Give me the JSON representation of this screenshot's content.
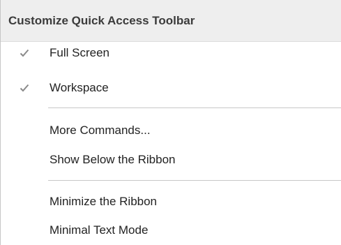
{
  "menu": {
    "title": "Customize Quick Access Toolbar",
    "items": [
      {
        "label": "Full Screen",
        "checked": true,
        "check_icon": "checkmark-icon"
      },
      {
        "label": "Workspace",
        "checked": true,
        "check_icon": "checkmark-icon"
      },
      {
        "label": "More Commands...",
        "checked": false
      },
      {
        "label": "Show Below the Ribbon",
        "checked": false
      },
      {
        "label": "Minimize the Ribbon",
        "checked": false
      },
      {
        "label": "Minimal Text Mode",
        "checked": false
      }
    ]
  },
  "colors": {
    "header_bg": "#eeeeee",
    "check_color": "#8a8a8a",
    "separator": "#c8c8c8"
  }
}
